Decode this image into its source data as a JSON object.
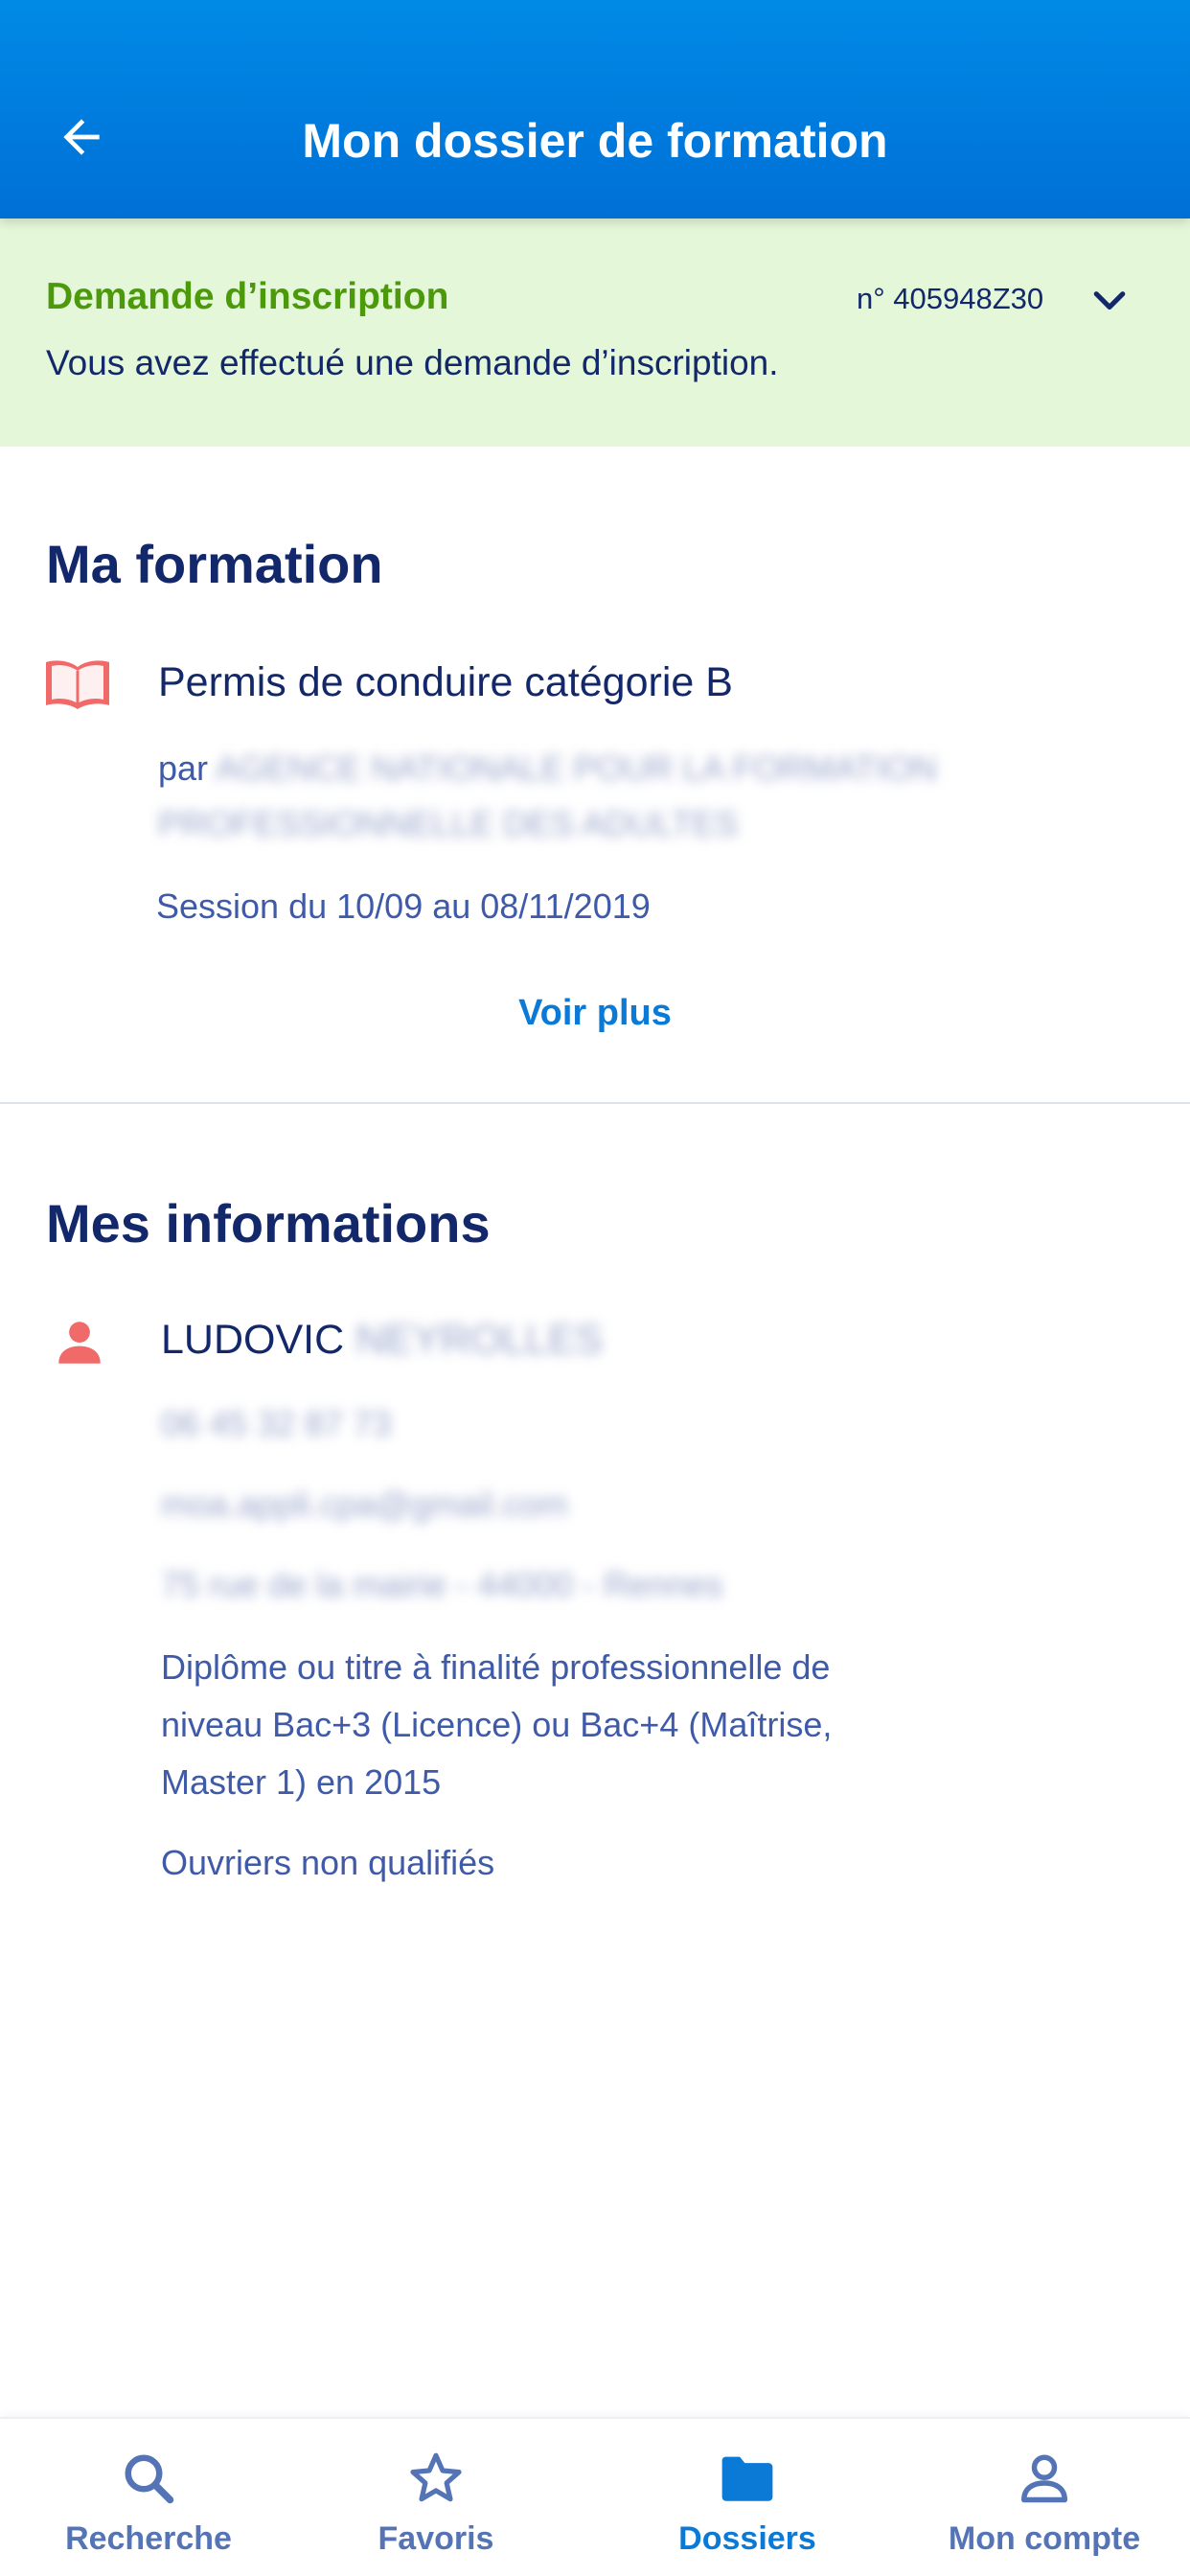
{
  "header": {
    "title": "Mon dossier de formation",
    "back_icon": "arrow-left-icon"
  },
  "status": {
    "title": "Demande d’inscription",
    "number": "n° 405948Z30",
    "description": "Vous avez effectué une demande d’inscription.",
    "color": "#4c9a0c",
    "background": "#e5f7d9"
  },
  "formation": {
    "section_title": "Ma formation",
    "icon": "open-book-icon",
    "title": "Permis de conduire catégorie B",
    "by_prefix": "par",
    "organization_line1": "AGENCE NATIONALE POUR LA FORMATION",
    "organization_line2": "PROFESSIONNELLE DES ADULTES",
    "session": "Session du 10/09 au 08/11/2019",
    "see_more": "Voir plus"
  },
  "informations": {
    "section_title": "Mes informations",
    "icon": "person-icon",
    "first_name": "LUDOVIC",
    "last_name": "NEYROLLES",
    "phone": "06 45 32 87 73",
    "email": "moa.appli.cpa@gmail.com",
    "address": "75 rue de la mairie - 44000 - Rennes",
    "diploma_line1": "Diplôme ou titre à finalité professionnelle de",
    "diploma_line2": "niveau Bac+3 (Licence) ou Bac+4 (Maîtrise,",
    "diploma_line3": "Master 1) en 2015",
    "category": "Ouvriers non qualifiés"
  },
  "bottom_nav": {
    "items": [
      {
        "label": "Recherche",
        "icon": "search-icon",
        "active": false
      },
      {
        "label": "Favoris",
        "icon": "star-icon",
        "active": false
      },
      {
        "label": "Dossiers",
        "icon": "folder-icon",
        "active": true
      },
      {
        "label": "Mon compte",
        "icon": "account-icon",
        "active": false
      }
    ]
  },
  "colors": {
    "primary": "#0a7ad6",
    "navy": "#13286a",
    "accent_red": "#f06a6a"
  }
}
